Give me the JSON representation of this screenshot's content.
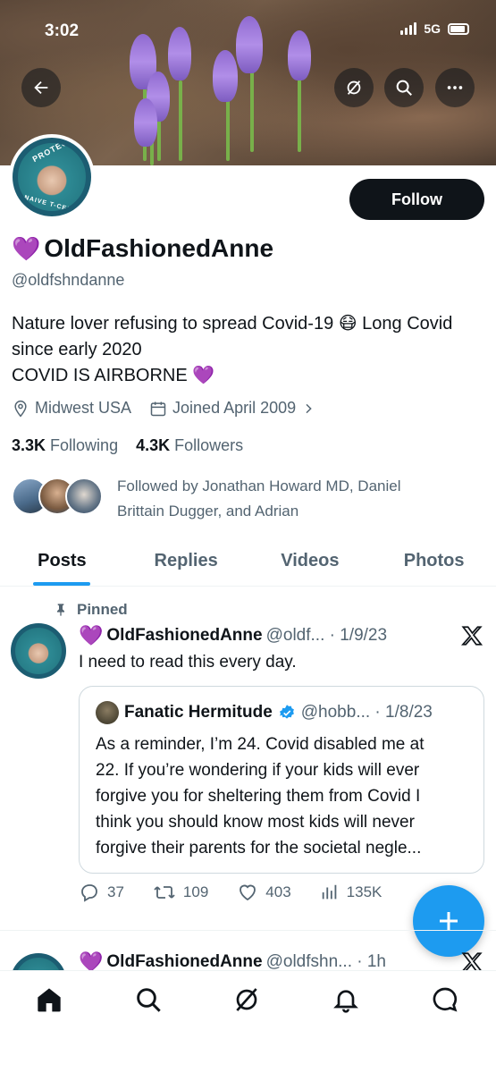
{
  "status_bar": {
    "time": "3:02",
    "network": "5G"
  },
  "profile": {
    "display_name": "OldFashionedAnne",
    "name_emoji": "💜",
    "handle": "@oldfshndanne",
    "follow_label": "Follow",
    "bio_lines": [
      "Nature lover refusing to spread Covid-19 😷 Long Covid",
      "since early 2020",
      "COVID IS AIRBORNE 💜"
    ],
    "avatar_ring_top": "PROTECT",
    "avatar_ring_bottom": "NAIVE T-CELLS",
    "location": "Midwest USA",
    "joined": "Joined April 2009",
    "following_count": "3.3K",
    "following_label": "Following",
    "followers_count": "4.3K",
    "followers_label": "Followers",
    "followed_by_lines": [
      "Followed by Jonathan Howard MD, Daniel",
      "Brittain Dugger, and Adrian"
    ]
  },
  "tabs": [
    "Posts",
    "Replies",
    "Videos",
    "Photos"
  ],
  "pinned_post": {
    "pinned_label": "Pinned",
    "author": "OldFashionedAnne",
    "author_emoji": "💜",
    "handle_date": "@oldf... · 1/9/23",
    "text": "I need to read this every day.",
    "quote": {
      "author": "Fanatic Hermitude",
      "handle_date": "@hobb... · 1/8/23",
      "lines": [
        "As a reminder, I’m 24. Covid disabled me at",
        "22. If you’re wondering if your kids will ever",
        "forgive you for sheltering them from Covid I",
        "think you should know most kids will never",
        "forgive their parents for the societal negle..."
      ]
    },
    "replies": "37",
    "reposts": "109",
    "likes": "403",
    "views": "135K"
  },
  "next_post": {
    "author": "OldFashionedAnne",
    "author_emoji": "💜",
    "handle_date": "@oldfshn... · 1h"
  },
  "colors": {
    "accent": "#1d9bf0",
    "text": "#0f1419",
    "secondary": "#536471",
    "heart": "#9b4fe0"
  },
  "icons": [
    "back-arrow-icon",
    "grok-icon",
    "search-icon",
    "more-icon",
    "location-icon",
    "calendar-icon",
    "pin-icon",
    "x-logo-icon",
    "reply-icon",
    "repost-icon",
    "like-icon",
    "views-icon",
    "compose-icon",
    "home-icon",
    "notifications-icon",
    "messages-icon"
  ]
}
